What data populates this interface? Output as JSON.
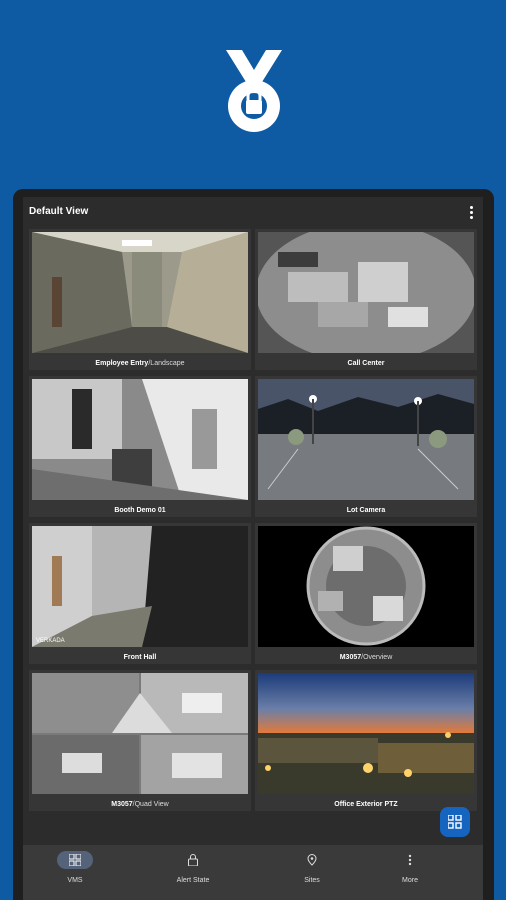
{
  "brand": {
    "logo_icon": "vms-lock-logo-icon",
    "bg_color": "#0e5aa3"
  },
  "view": {
    "title": "Default View",
    "menu_icon": "more-vertical-icon"
  },
  "cameras": [
    {
      "name": "Employee Entry",
      "alt": "Landscape"
    },
    {
      "name": "Call Center",
      "alt": ""
    },
    {
      "name": "Booth Demo 01",
      "alt": ""
    },
    {
      "name": "Lot Camera",
      "alt": ""
    },
    {
      "name": "Front Hall",
      "alt": "",
      "watermark": "VERKADA"
    },
    {
      "name": "M3057",
      "alt": "Overview"
    },
    {
      "name": "M3057",
      "alt": "Quad View"
    },
    {
      "name": "Office Exterior PTZ",
      "alt": ""
    }
  ],
  "fab": {
    "icon": "grid-view-icon",
    "color": "#1565c0"
  },
  "nav": [
    {
      "label": "VMS",
      "icon": "grid-icon",
      "active": true
    },
    {
      "label": "Alert State",
      "icon": "lock-icon",
      "active": false
    },
    {
      "label": "Sites",
      "icon": "location-pin-icon",
      "active": false
    },
    {
      "label": "More",
      "icon": "more-vertical-icon",
      "active": false
    }
  ]
}
